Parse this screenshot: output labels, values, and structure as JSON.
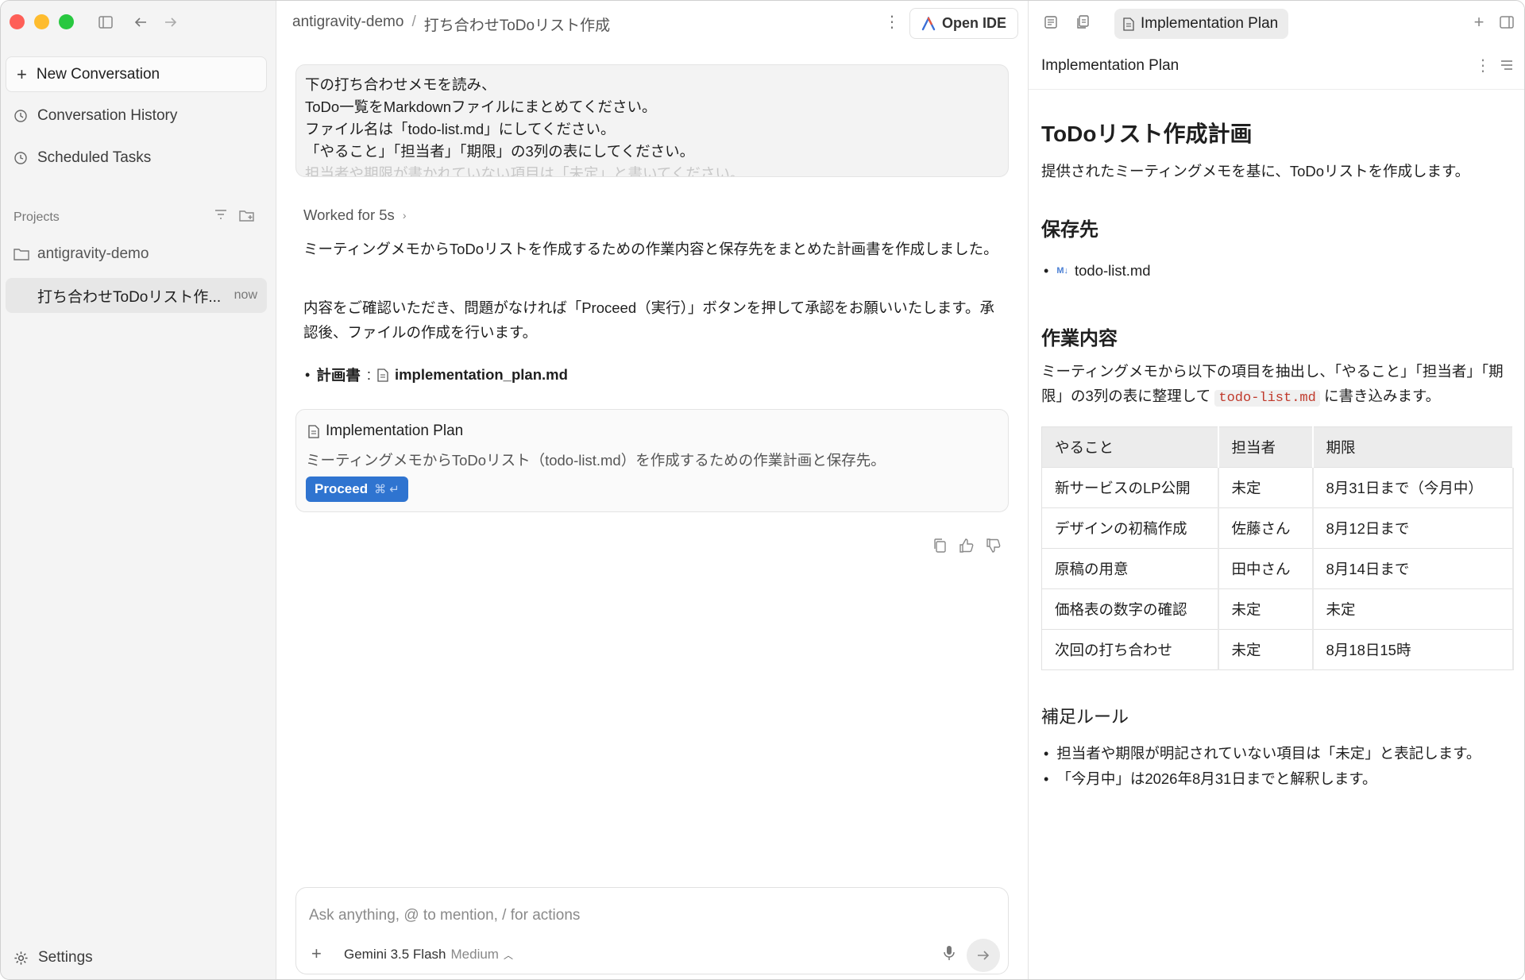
{
  "sidebar": {
    "new_conversation": "New Conversation",
    "conversation_history": "Conversation History",
    "scheduled_tasks": "Scheduled Tasks",
    "projects_label": "Projects",
    "project_name": "antigravity-demo",
    "conversation_title": "打ち合わせToDoリスト作...",
    "conversation_time": "now",
    "settings": "Settings"
  },
  "header": {
    "project": "antigravity-demo",
    "separator": "/",
    "conversation": "打ち合わせToDoリスト作成",
    "open_ide": "Open IDE"
  },
  "chat": {
    "user_lines": [
      "下の打ち合わせメモを読み、",
      "ToDo一覧をMarkdownファイルにまとめてください。",
      "ファイル名は「todo-list.md」にしてください。",
      "「やること」「担当者」「期限」の3列の表にしてください。",
      "担当者や期限が書かれていない項目は「未定」と書いてください。"
    ],
    "worked_for": "Worked for 5s",
    "reply_1": "ミーティングメモからToDoリストを作成するための作業内容と保存先をまとめた計画書を作成しました。",
    "reply_2": "内容をご確認いただき、問題がなければ「Proceed（実行）」ボタンを押して承認をお願いいたします。承認後、ファイルの作成を行います。",
    "bullet_label": "計画書",
    "bullet_colon": ":",
    "bullet_file": "implementation_plan.md",
    "card_title": "Implementation Plan",
    "card_desc": "ミーティングメモからToDoリスト（todo-list.md）を作成するための作業計画と保存先。",
    "proceed": "Proceed",
    "proceed_shortcut": "⌘ ↵"
  },
  "input": {
    "placeholder": "Ask anything, @ to mention, / for actions",
    "model": "Gemini 3.5 Flash",
    "mode": "Medium"
  },
  "panel": {
    "tab_title": "Implementation Plan",
    "header_title": "Implementation Plan",
    "doc_title": "ToDoリスト作成計画",
    "intro": "提供されたミーティングメモを基に、ToDoリストを作成します。",
    "h_save": "保存先",
    "save_file": "todo-list.md",
    "h_work": "作業内容",
    "work_text_1": "ミーティングメモから以下の項目を抽出し、「やること」「担当者」「期限」の3列の表に整理して",
    "work_code": "todo-list.md",
    "work_text_2": "に書き込みます。",
    "table_headers": [
      "やること",
      "担当者",
      "期限"
    ],
    "table_rows": [
      [
        "新サービスのLP公開",
        "未定",
        "8月31日まで（今月中）"
      ],
      [
        "デザインの初稿作成",
        "佐藤さん",
        "8月12日まで"
      ],
      [
        "原稿の用意",
        "田中さん",
        "8月14日まで"
      ],
      [
        "価格表の数字の確認",
        "未定",
        "未定"
      ],
      [
        "次回の打ち合わせ",
        "未定",
        "8月18日15時"
      ]
    ],
    "h_rules": "補足ルール",
    "rules": [
      "担当者や期限が明記されていない項目は「未定」と表記します。",
      "「今月中」は2026年8月31日までと解釈します。"
    ]
  },
  "colors": {
    "accent": "#2f74d0",
    "close": "#fe5f57",
    "minimize": "#febc2e",
    "maximize": "#28c840"
  }
}
